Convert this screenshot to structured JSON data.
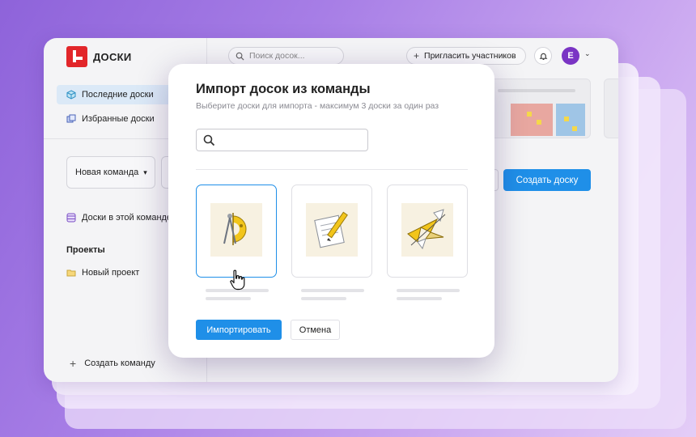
{
  "app": {
    "logo_text": "ДОСКИ",
    "brand_color": "#e2262a",
    "accent_color": "#1f8fe8"
  },
  "sidebar": {
    "items": [
      {
        "label": "Последние доски",
        "icon": "cube-icon",
        "active": true
      },
      {
        "label": "Избранные доски",
        "icon": "cubes-icon",
        "active": false
      }
    ],
    "team_select": "Новая команда",
    "team_boards": "Доски в этой команде",
    "projects_title": "Проекты",
    "project_item": "Новый проект",
    "create_team": "Создать команду"
  },
  "header": {
    "search_placeholder": "Поиск досок...",
    "invite_label": "Пригласить участников",
    "avatar_letter": "E"
  },
  "main": {
    "create_board_label": "Создать доску"
  },
  "modal": {
    "title": "Импорт досок из команды",
    "subtitle": "Выберите доски для импорта - максимум 3 доски за один раз",
    "search_value": "",
    "cards": [
      {
        "icon": "compass-ruler-icon",
        "selected": true
      },
      {
        "icon": "notepad-pencil-icon",
        "selected": false
      },
      {
        "icon": "origami-icon",
        "selected": false
      }
    ],
    "import_label": "Импортировать",
    "cancel_label": "Отмена"
  }
}
